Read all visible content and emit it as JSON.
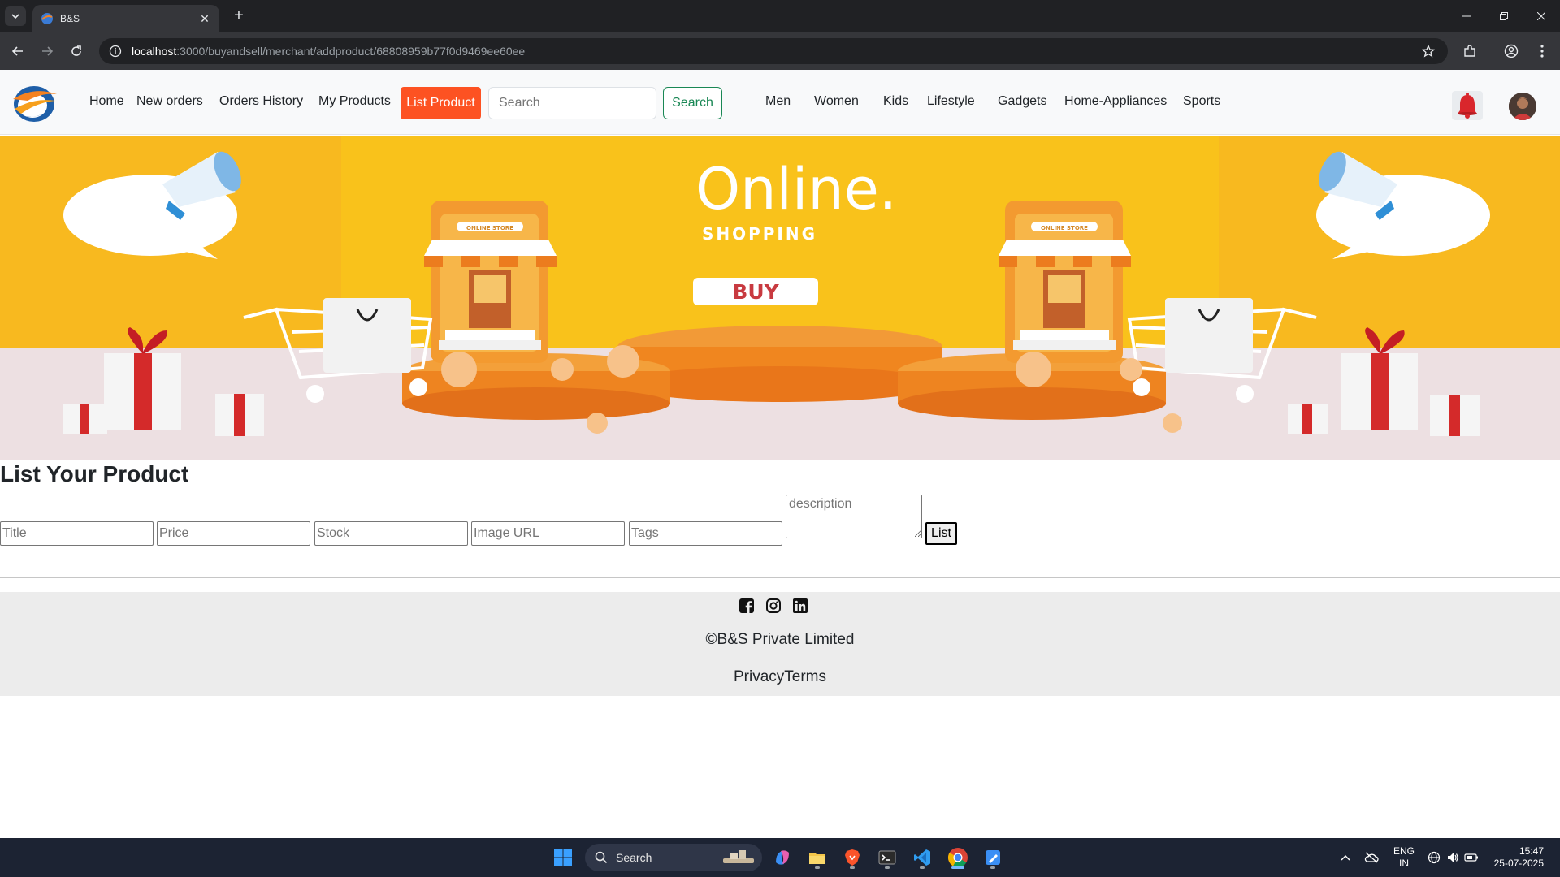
{
  "browser": {
    "tab_title": "B&S",
    "url_host": "localhost",
    "url_path": ":3000/buyandsell/merchant/addproduct/68808959b77f0d9469ee60ee"
  },
  "header": {
    "nav": [
      "Home",
      "New orders",
      "Orders History",
      "My Products"
    ],
    "list_product_label": "List Product",
    "search_placeholder": "Search",
    "search_button": "Search",
    "categories": [
      "Men",
      "Women",
      "Kids",
      "Lifestyle",
      "Gadgets",
      "Home-Appliances",
      "Sports"
    ]
  },
  "banner": {
    "headline": "Online.",
    "subline": "SHOPPING",
    "cta": "BUY",
    "store_sign": "ONLINE STORE"
  },
  "form": {
    "title": "List Your Product",
    "placeholders": {
      "title": "Title",
      "price": "Price",
      "stock": "Stock",
      "image_url": "Image URL",
      "tags": "Tags",
      "description": "description"
    },
    "submit": "List"
  },
  "footer": {
    "social": [
      "facebook-icon",
      "instagram-icon",
      "linkedin-icon"
    ],
    "copyright": "©B&S Private Limited",
    "links": "PrivacyTerms"
  },
  "taskbar": {
    "search": "Search",
    "lang": "ENG",
    "region": "IN",
    "time": "15:47",
    "date": "25-07-2025"
  },
  "colors": {
    "accent": "#fd5222",
    "search_green": "#198754",
    "banner_yellow": "#fbcc17"
  }
}
